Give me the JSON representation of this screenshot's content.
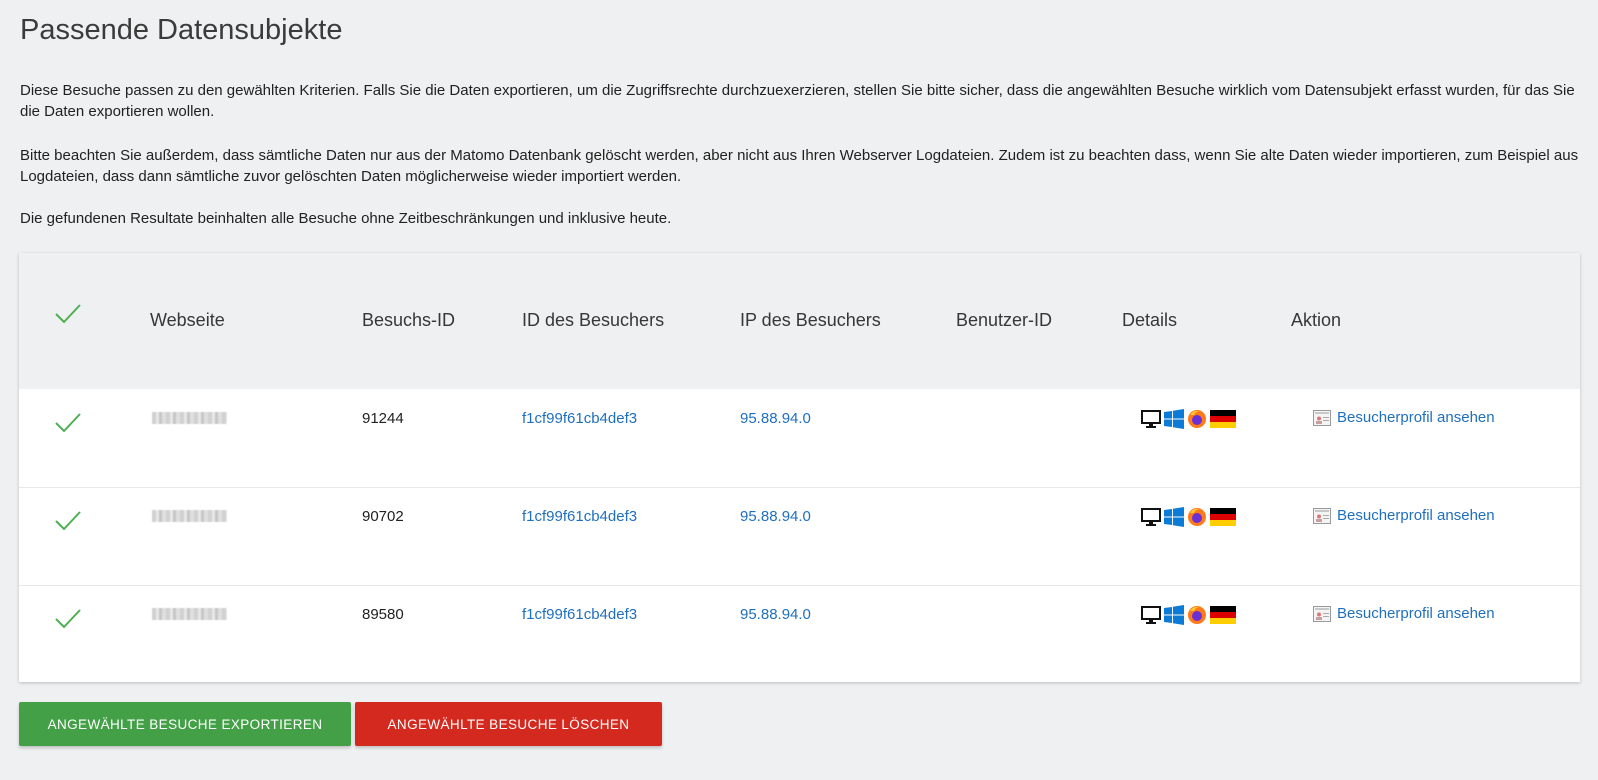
{
  "title": "Passende Datensubjekte",
  "intro": {
    "p1": "Diese Besuche passen zu den gewählten Kriterien. Falls Sie die Daten exportieren, um die Zugriffsrechte durchzuexerzieren, stellen Sie bitte sicher, dass die angewählten Besuche wirklich vom Datensubjekt erfasst wurden, für das Sie die Daten exportieren wollen.",
    "p2": "Bitte beachten Sie außerdem, dass sämtliche Daten nur aus der Matomo Datenbank gelöscht werden, aber nicht aus Ihren Webserver Logdateien. Zudem ist zu beachten dass, wenn Sie alte Daten wieder importieren, zum Beispiel aus Logdateien, dass dann sämtliche zuvor gelöschten Daten möglicherweise wieder importiert werden.",
    "p3": "Die gefundenen Resultate beinhalten alle Besuche ohne Zeitbeschränkungen und inklusive heute."
  },
  "table": {
    "headers": {
      "website": "Webseite",
      "visit_id": "Besuchs-ID",
      "visitor_id": "ID des Besuchers",
      "visitor_ip": "IP des Besuchers",
      "user_id": "Benutzer-ID",
      "details": "Details",
      "action": "Aktion"
    },
    "rows": [
      {
        "visit_id": "91244",
        "visitor_id": "f1cf99f61cb4def3",
        "visitor_ip": "95.88.94.0",
        "user_id": "",
        "action": "Besucherprofil ansehen"
      },
      {
        "visit_id": "90702",
        "visitor_id": "f1cf99f61cb4def3",
        "visitor_ip": "95.88.94.0",
        "user_id": "",
        "action": "Besucherprofil ansehen"
      },
      {
        "visit_id": "89580",
        "visitor_id": "f1cf99f61cb4def3",
        "visitor_ip": "95.88.94.0",
        "user_id": "",
        "action": "Besucherprofil ansehen"
      }
    ],
    "detail_icons": [
      "desktop-icon",
      "windows-icon",
      "firefox-icon",
      "germany-flag-icon"
    ]
  },
  "buttons": {
    "export": "ANGEWÄHLTE BESUCHE EXPORTIEREN",
    "delete": "ANGEWÄHLTE BESUCHE LÖSCHEN"
  },
  "colors": {
    "check": "#4caf50",
    "link": "#1f6fbf",
    "export_button": "#43a047",
    "delete_button": "#d4291f"
  }
}
